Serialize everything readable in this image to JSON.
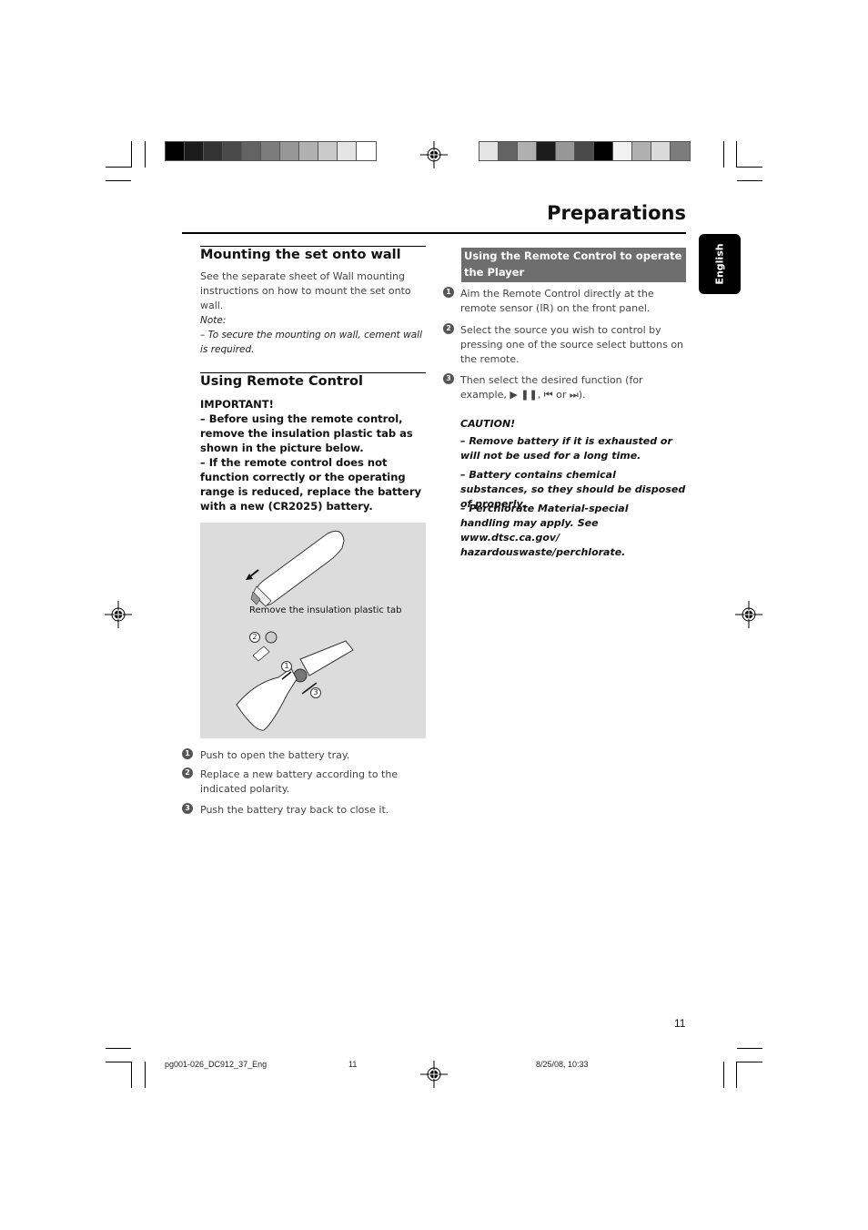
{
  "page": {
    "title": "Preparations",
    "language_tab": "English",
    "page_number": "11"
  },
  "color_bars": {
    "left": [
      "#000000",
      "#1c1c1c",
      "#333333",
      "#4a4a4a",
      "#636363",
      "#7c7c7c",
      "#979797",
      "#b0b0b0",
      "#cacaca",
      "#e4e4e4",
      "#ffffff"
    ],
    "right": [
      "#e4e4e4",
      "#636363",
      "#b0b0b0",
      "#1c1c1c",
      "#979797",
      "#4a4a4a",
      "#000000",
      "#f2f2f2",
      "#b0b0b0",
      "#dadada",
      "#7c7c7c"
    ]
  },
  "mounting": {
    "heading": "Mounting the set onto wall",
    "body": "See the separate sheet of Wall mounting instructions on how to mount the set onto wall.",
    "note_label": "Note:",
    "note_text": "–  To secure the mounting on wall, cement wall is required."
  },
  "remote": {
    "heading": "Using Remote Control",
    "important_label": "IMPORTANT!",
    "important_1": "–  Before using the remote control, remove the insulation plastic tab as shown in the picture below.",
    "important_2": "–  If the remote control does not function correctly or the operating range is reduced, replace the battery with a new (CR2025) battery.",
    "illustration_caption": "Remove the insulation plastic tab",
    "illustration_callouts": [
      "1",
      "2",
      "3"
    ],
    "steps": [
      {
        "num": "1",
        "text": "Push to open the battery tray."
      },
      {
        "num": "2",
        "text": "Replace a new battery according to the indicated polarity."
      },
      {
        "num": "3",
        "text": "Push the battery tray back to close it."
      }
    ]
  },
  "operate": {
    "heading": "Using the Remote Control to operate the Player",
    "steps": [
      {
        "num": "1",
        "text": "Aim the Remote Control directly at the remote sensor (IR) on the front panel."
      },
      {
        "num": "2",
        "text": "Select the source you wish to control by pressing one of the source select buttons on the remote."
      },
      {
        "num": "3",
        "text": "Then select the desired function (for example, ▶ ❚❚, ⏮ or ⏭)."
      }
    ],
    "caution_label": "CAUTION!",
    "cautions": [
      "–  Remove battery if it is exhausted or will not be used for a long time.",
      "–  Battery contains chemical substances, so they should be disposed of properly.",
      "–  Perchlorate Material-special handling may apply. See www.dtsc.ca.gov/ hazardouswaste/perchlorate."
    ]
  },
  "footer": {
    "file": "pg001-026_DC912_37_Eng",
    "page": "11",
    "datetime": "8/25/08, 10:33"
  }
}
